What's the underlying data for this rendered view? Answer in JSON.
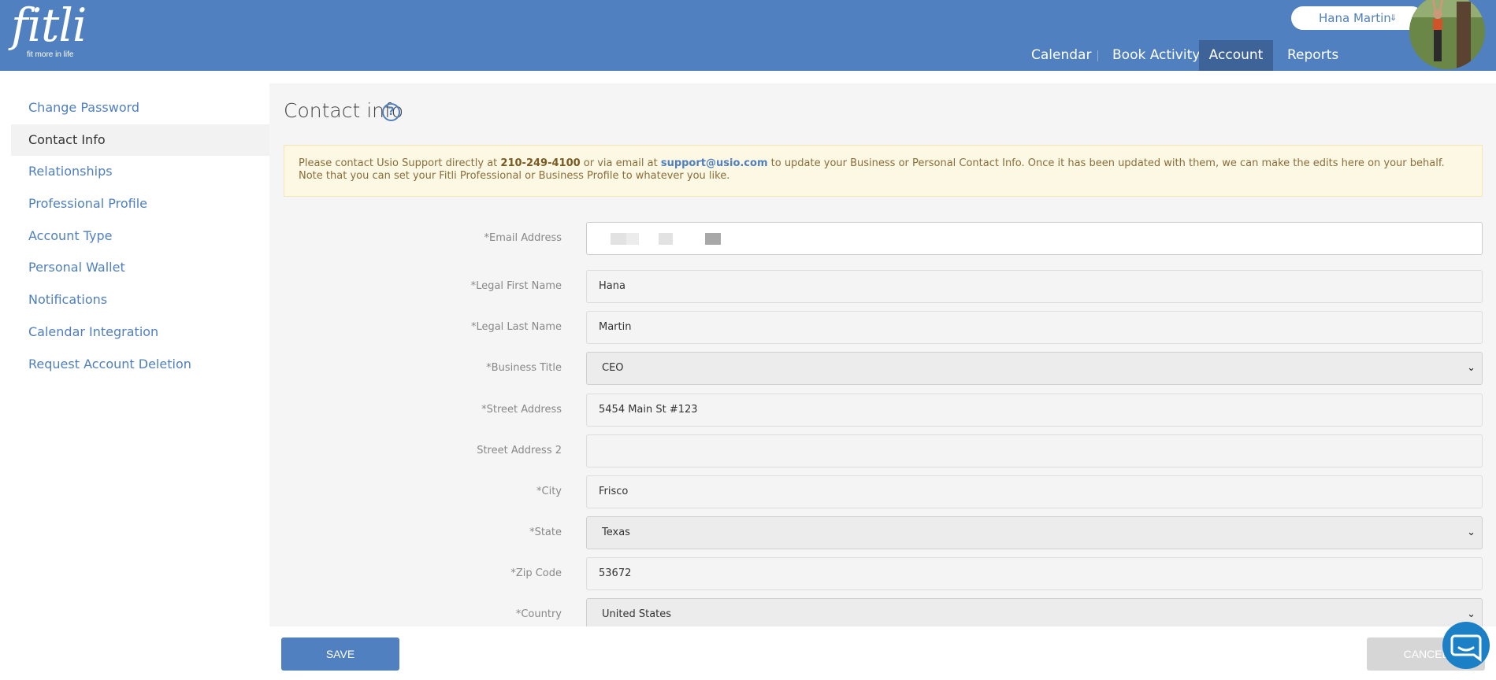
{
  "brand": {
    "logo": "fitli",
    "tagline": "fit more in life"
  },
  "user": {
    "name": "Hana Martin",
    "menu_icon": "double-chevron-down-icon"
  },
  "nav": {
    "items": [
      {
        "label": "Calendar"
      },
      {
        "label": "Book Activity"
      },
      {
        "label": "Account",
        "active": true
      },
      {
        "label": "Reports"
      }
    ]
  },
  "sidebar": {
    "items": [
      {
        "label": "Change Password"
      },
      {
        "label": "Contact Info",
        "active": true
      },
      {
        "label": "Relationships"
      },
      {
        "label": "Professional Profile"
      },
      {
        "label": "Account Type"
      },
      {
        "label": "Personal Wallet"
      },
      {
        "label": "Notifications"
      },
      {
        "label": "Calendar Integration"
      },
      {
        "label": "Request Account Deletion"
      }
    ]
  },
  "page": {
    "title": "Contact info",
    "help_icon": "?"
  },
  "notice": {
    "text1": "Please contact Usio Support directly at ",
    "phone": "210-249-4100",
    "text2": " or via email at ",
    "email": "support@usio.com",
    "text3": " to update your Business or Personal Contact Info. Once it has been updated with them, we can make the edits here on your behalf. Note that you can set your Fitli Professional or Business Profile to whatever you like."
  },
  "form": {
    "email": {
      "label": "*Email Address",
      "value": ""
    },
    "first_name": {
      "label": "*Legal First Name",
      "value": "Hana"
    },
    "last_name": {
      "label": "*Legal Last Name",
      "value": "Martin"
    },
    "business_title": {
      "label": "*Business Title",
      "value": "CEO"
    },
    "street": {
      "label": "*Street Address",
      "value": "5454 Main St #123"
    },
    "street2": {
      "label": "Street Address 2",
      "value": ""
    },
    "city": {
      "label": "*City",
      "value": "Frisco"
    },
    "state": {
      "label": "*State",
      "value": "Texas"
    },
    "zip": {
      "label": "*Zip Code",
      "value": "53672"
    },
    "country": {
      "label": "*Country",
      "value": "United States"
    }
  },
  "footer": {
    "save_label": "SAVE",
    "cancel_label": "CANCEL"
  },
  "colors": {
    "header": "#5080bf",
    "nav_active": "#3d6399",
    "notice_bg": "#fcf8e3",
    "chat": "#1c80c7"
  }
}
